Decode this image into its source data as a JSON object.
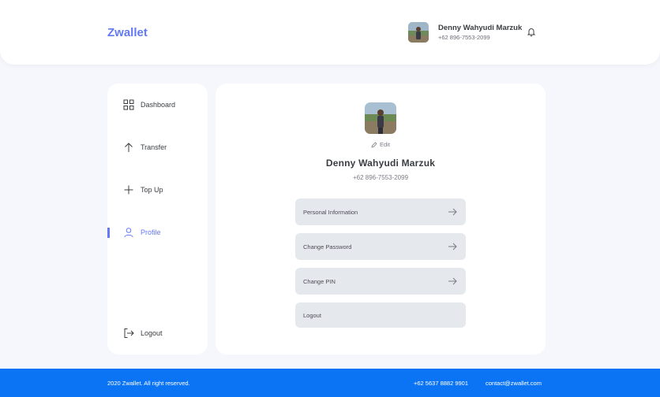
{
  "header": {
    "brand": "Zwallet",
    "user_name": "Denny Wahyudi Marzuk",
    "user_phone": "+62 896-7553-2099"
  },
  "sidebar": {
    "items": [
      {
        "label": "Dashboard",
        "icon": "grid-icon"
      },
      {
        "label": "Transfer",
        "icon": "arrow-up-icon"
      },
      {
        "label": "Top Up",
        "icon": "plus-icon"
      },
      {
        "label": "Profile",
        "icon": "user-icon",
        "active": true
      }
    ],
    "logout_label": "Logout"
  },
  "profile": {
    "edit_label": "Edit",
    "name": "Denny Wahyudi Marzuk",
    "phone": "+62 896-7553-2099",
    "menu": [
      {
        "label": "Personal Information"
      },
      {
        "label": "Change Password"
      },
      {
        "label": "Change PIN"
      },
      {
        "label": "Logout"
      }
    ]
  },
  "footer": {
    "copyright": "2020 Zwallet. All right reserved.",
    "phone": "+62 5637 8882 9901",
    "email": "contact@zwallet.com"
  },
  "colors": {
    "accent": "#6379F4",
    "footer_bg": "#0B74F5",
    "page_bg": "#F5F7FD",
    "menu_button_bg": "#E5E8ED"
  }
}
